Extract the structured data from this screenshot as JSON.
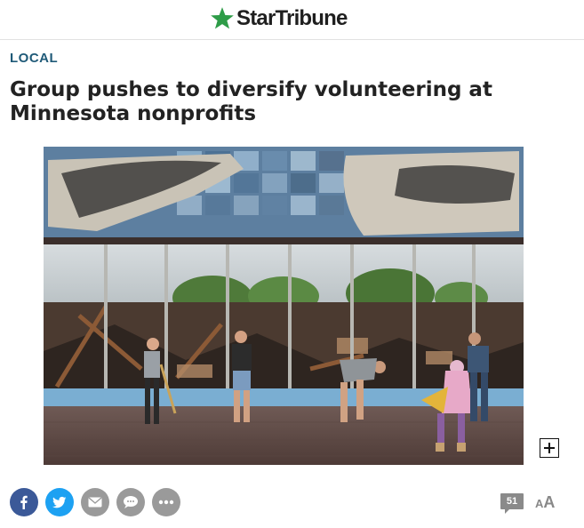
{
  "header": {
    "logo_text": "StarTribune",
    "logo_star_color": "#2e9c48"
  },
  "article": {
    "section": "LOCAL",
    "headline": "Group pushes to diversify volunteering at Minnesota nonprofits",
    "photo": {
      "subject": "volunteers sweeping debris in front of a burned-out building with a mural",
      "expand_icon": "plus-icon"
    }
  },
  "share": {
    "buttons": [
      {
        "name": "facebook",
        "icon": "facebook-icon",
        "color": "#3b5998"
      },
      {
        "name": "twitter",
        "icon": "twitter-icon",
        "color": "#1da1f2"
      },
      {
        "name": "email",
        "icon": "email-icon",
        "color": "#9a9a9a"
      },
      {
        "name": "sms",
        "icon": "chat-icon",
        "color": "#9a9a9a"
      },
      {
        "name": "more",
        "icon": "more-icon",
        "color": "#9a9a9a"
      }
    ]
  },
  "comments": {
    "count": "51"
  },
  "font_toggle": {
    "small": "A",
    "large": "A"
  },
  "colors": {
    "section": "#1f5a78",
    "headline": "#222222",
    "icon_gray": "#9a9a9a"
  }
}
